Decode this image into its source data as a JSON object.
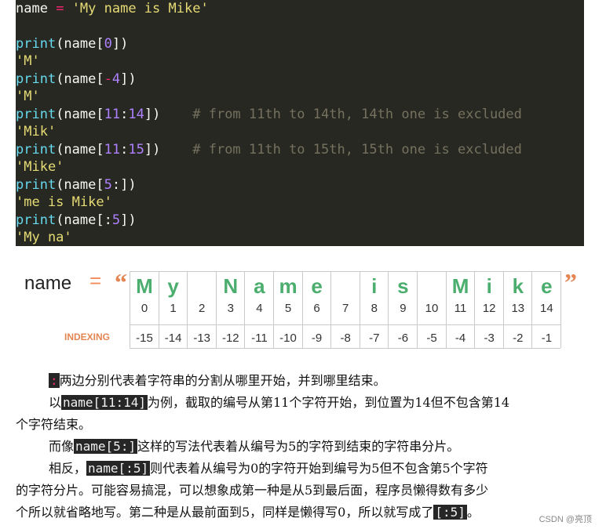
{
  "code": {
    "lines": [
      "name = 'My name is Mike'",
      "",
      "print(name[0])",
      "'M'",
      "print(name[-4])",
      "'M'",
      "print(name[11:14])    # from 11th to 14th, 14th one is excluded",
      "'Mik'",
      "print(name[11:15])    # from 11th to 15th, 15th one is excluded",
      "'Mike'",
      "print(name[5:])",
      "'me is Mike'",
      "print(name[:5])",
      "'My na'"
    ]
  },
  "diagram": {
    "var_label": "name",
    "equals": "=",
    "open_quote": "“",
    "close_quote": "”",
    "indexing_label": "INDEXING",
    "chars": [
      "M",
      "y",
      "",
      "N",
      "a",
      "m",
      "e",
      "",
      "i",
      "s",
      "",
      "M",
      "i",
      "k",
      "e"
    ],
    "positive_index": [
      "0",
      "1",
      "2",
      "3",
      "4",
      "5",
      "6",
      "7",
      "8",
      "9",
      "10",
      "11",
      "12",
      "13",
      "14"
    ],
    "negative_index": [
      "-15",
      "-14",
      "-13",
      "-12",
      "-11",
      "-10",
      "-9",
      "-8",
      "-7",
      "-6",
      "-5",
      "-4",
      "-3",
      "-2",
      "-1"
    ]
  },
  "text": {
    "p1_colon": ":",
    "p1": "两边分别代表着字符串的分割从哪里开始，并到哪里结束。",
    "p2_pre": "以",
    "p2_code": "name[11:14]",
    "p2_a": "为例，截取的编号从第11个字符开始，到位置为14但不包含第14",
    "p2_b": "个字符结束。",
    "p3_pre": "而像",
    "p3_code": "name[5:]",
    "p3_post": "这样的写法代表着从编号为5的字符到结束的字符串分片。",
    "p4_pre": "相反，",
    "p4_code": "name[:5]",
    "p4_a": "则代表着从编号为0的字符开始到编号为5但不包含第5个字符",
    "p4_b": "的字符分片。可能容易搞混，可以想象成第一种是从5到最后面，程序员懒得数有多少",
    "p4_c": "个所以就省略地写。第二种是从最前面到5，同样是懒得写0，所以就写成了",
    "p4_code2": "[:5]",
    "p4_end": "。"
  },
  "watermark": "CSDN @亮顶"
}
